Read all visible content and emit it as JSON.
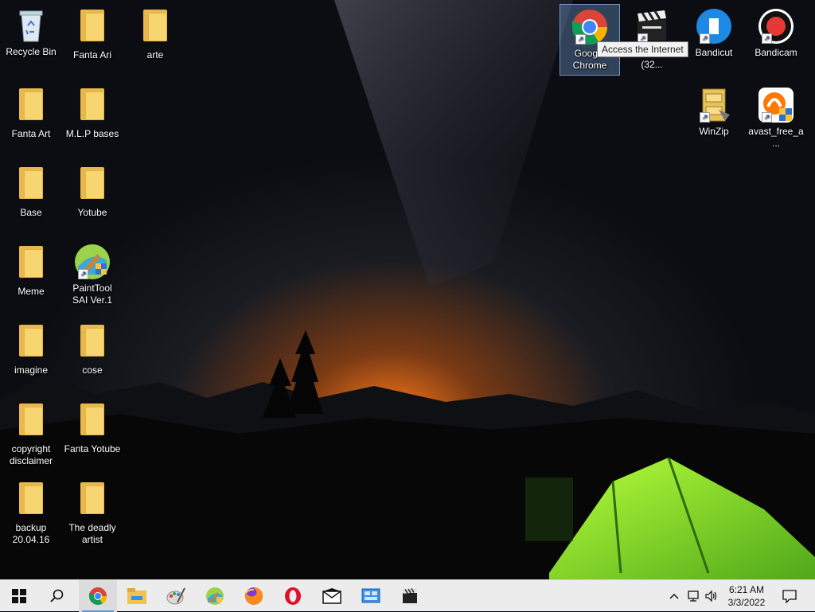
{
  "tooltip": "Access the Internet",
  "desktop": {
    "recycle_bin": "Recycle Bin",
    "fanta_ari": "Fanta Ari",
    "arte": "arte",
    "fanta_art": "Fanta Art",
    "mlp_bases": "M.L.P bases",
    "base": "Base",
    "yotube": "Yotube",
    "meme": "Meme",
    "painttool_sai": "PaintTool SAI Ver.1",
    "imagine": "imagine",
    "cose": "cose",
    "copyright_disclaimer": "copyright disclaimer",
    "fanta_yotube": "Fanta Yotube",
    "backup": "backup 20.04.16",
    "the_deadly_artist": "The deadly artist",
    "google_chrome": "Google Chrome",
    "bits_app": "- 32 bits (32...",
    "bandicut": "Bandicut",
    "bandicam": "Bandicam",
    "winzip": "WinZip",
    "avast": "avast_free_a..."
  },
  "taskbar": {
    "pinned": [
      "start-button",
      "search-icon",
      "chrome-icon",
      "file-explorer-icon",
      "paint-icon",
      "painttool-sai-icon",
      "firefox-icon",
      "opera-icon",
      "mail-icon",
      "control-panel-icon",
      "video-editor-icon"
    ],
    "time": "6:21 AM",
    "date": "3/3/2022"
  },
  "colors": {
    "taskbar_bg": "#ececec",
    "folder_yellow": "#f7d571",
    "selection": "#78aae6"
  }
}
